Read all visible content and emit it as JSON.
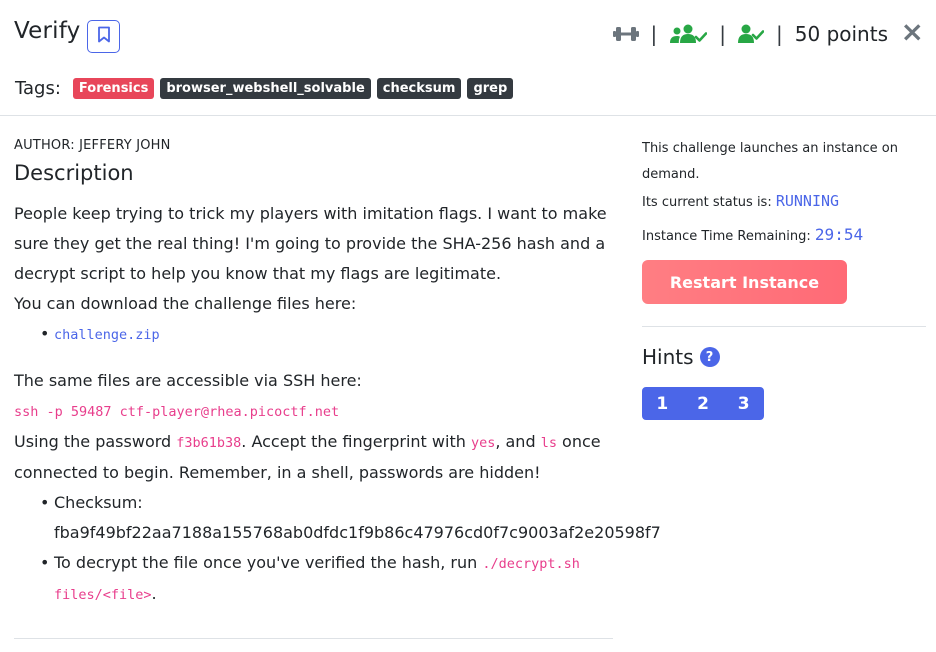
{
  "header": {
    "title": "Verify",
    "points": "50 points",
    "separator": "|",
    "close_glyph": "×",
    "icons": [
      "dumbbell-icon",
      "users-check-icon",
      "user-check-icon",
      "bookmark-icon",
      "close-icon"
    ]
  },
  "tags": {
    "label": "Tags:",
    "items": [
      "Forensics",
      "browser_webshell_solvable",
      "checksum",
      "grep"
    ]
  },
  "author": "AUTHOR: JEFFERY JOHN",
  "description": {
    "heading": "Description",
    "text": "People keep trying to trick my players with imitation flags. I want to make sure they get the real thing! I'm going to provide the SHA-256 hash and a decrypt script to help you know that my flags are legitimate.",
    "download_text": "You can download the challenge files here:",
    "download_link": "challenge.zip",
    "ssh_text": "The same files are accessible via SSH here:",
    "ssh_command": "ssh -p 59487 ctf-player@rhea.picoctf.net",
    "password_prefix": "Using the password ",
    "password": "f3b61b38",
    "fingerprint_text": ". Accept the fingerprint with ",
    "yes": "yes",
    "and_text": ", and ",
    "ls": "ls",
    "connect_text": " once connected to begin. Remember, in a shell, passwords are hidden!",
    "checksum_label": "Checksum:",
    "checksum_value": "fba9f49bf22aa7188a155768ab0dfdc1f9b86c47976cd0f7c9003af2e20598f7",
    "decrypt_text": "To decrypt the file once you've verified the hash, run ",
    "decrypt_command": "./decrypt.sh files/<file>",
    "period": "."
  },
  "instance": {
    "launch_text": "This challenge launches an instance on demand.",
    "status_label": "Its current status is: ",
    "status_value": "RUNNING",
    "time_label": "Instance Time Remaining: ",
    "time_value": "29:54",
    "restart_label": "Restart Instance"
  },
  "hints": {
    "title": "Hints",
    "help_glyph": "?",
    "buttons": [
      "1",
      "2",
      "3"
    ]
  },
  "colors": {
    "accent": "#4b66e8",
    "forensics_tag": "#e8465a",
    "dark_tag": "#343a40",
    "success": "#28a745",
    "code": "#e83e8c",
    "restart": "#ff7080"
  }
}
